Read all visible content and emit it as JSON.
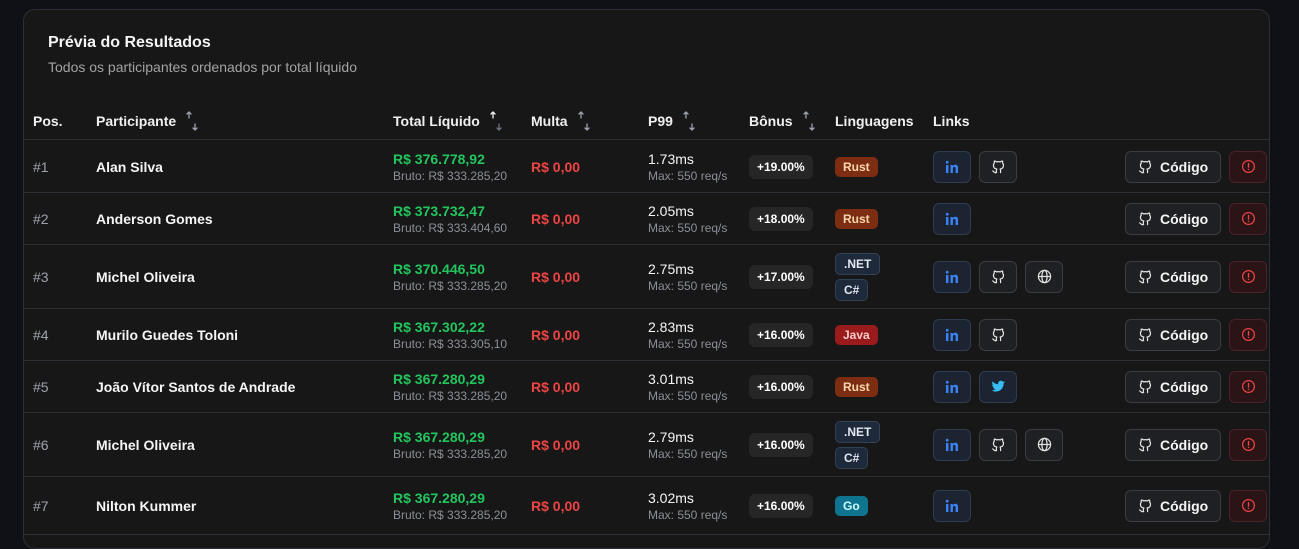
{
  "card": {
    "title": "Prévia do Resultados",
    "subtitle": "Todos os participantes ordenados por total líquido"
  },
  "columns": {
    "pos": "Pos.",
    "participant": "Participante",
    "total": "Total Líquido",
    "multa": "Multa",
    "p99": "P99",
    "bonus": "Bônus",
    "langs": "Linguagens",
    "links": "Links"
  },
  "colors": {
    "positive": "#22c55e",
    "negative": "#ef4444",
    "linkedin": "#3b82f6",
    "twitter": "#38bdf8"
  },
  "code_label": "Código",
  "rows": [
    {
      "pos": "#1",
      "name": "Alan Silva",
      "total": "R$ 376.778,92",
      "bruto": "Bruto: R$ 333.285,20",
      "multa": "R$ 0,00",
      "p99": "1.73ms",
      "max": "Max: 550 req/s",
      "bonus": "+19.00%",
      "langs": [
        {
          "label": "Rust",
          "kind": "rust"
        }
      ],
      "links": [
        "linkedin-icon",
        "github-icon"
      ]
    },
    {
      "pos": "#2",
      "name": "Anderson Gomes",
      "total": "R$ 373.732,47",
      "bruto": "Bruto: R$ 333.404,60",
      "multa": "R$ 0,00",
      "p99": "2.05ms",
      "max": "Max: 550 req/s",
      "bonus": "+18.00%",
      "langs": [
        {
          "label": "Rust",
          "kind": "rust"
        }
      ],
      "links": [
        "linkedin-icon"
      ]
    },
    {
      "pos": "#3",
      "name": "Michel Oliveira",
      "total": "R$ 370.446,50",
      "bruto": "Bruto: R$ 333.285,20",
      "multa": "R$ 0,00",
      "p99": "2.75ms",
      "max": "Max: 550 req/s",
      "bonus": "+17.00%",
      "langs": [
        {
          "label": ".NET",
          "kind": "net"
        },
        {
          "label": "C#",
          "kind": "cs"
        }
      ],
      "links": [
        "linkedin-icon",
        "github-icon",
        "globe-icon"
      ]
    },
    {
      "pos": "#4",
      "name": "Murilo Guedes Toloni",
      "total": "R$ 367.302,22",
      "bruto": "Bruto: R$ 333.305,10",
      "multa": "R$ 0,00",
      "p99": "2.83ms",
      "max": "Max: 550 req/s",
      "bonus": "+16.00%",
      "langs": [
        {
          "label": "Java",
          "kind": "java"
        }
      ],
      "links": [
        "linkedin-icon",
        "github-icon"
      ]
    },
    {
      "pos": "#5",
      "name": "João Vítor Santos de Andrade",
      "total": "R$ 367.280,29",
      "bruto": "Bruto: R$ 333.285,20",
      "multa": "R$ 0,00",
      "p99": "3.01ms",
      "max": "Max: 550 req/s",
      "bonus": "+16.00%",
      "langs": [
        {
          "label": "Rust",
          "kind": "rust"
        }
      ],
      "links": [
        "linkedin-icon",
        "twitter-icon"
      ]
    },
    {
      "pos": "#6",
      "name": "Michel Oliveira",
      "total": "R$ 367.280,29",
      "bruto": "Bruto: R$ 333.285,20",
      "multa": "R$ 0,00",
      "p99": "2.79ms",
      "max": "Max: 550 req/s",
      "bonus": "+16.00%",
      "langs": [
        {
          "label": ".NET",
          "kind": "net"
        },
        {
          "label": "C#",
          "kind": "cs"
        }
      ],
      "links": [
        "linkedin-icon",
        "github-icon",
        "globe-icon"
      ]
    },
    {
      "pos": "#7",
      "name": "Nilton Kummer",
      "total": "R$ 367.280,29",
      "bruto": "Bruto: R$ 333.285,20",
      "multa": "R$ 0,00",
      "p99": "3.02ms",
      "max": "Max: 550 req/s",
      "bonus": "+16.00%",
      "langs": [
        {
          "label": "Go",
          "kind": "go"
        }
      ],
      "links": [
        "linkedin-icon"
      ]
    }
  ]
}
